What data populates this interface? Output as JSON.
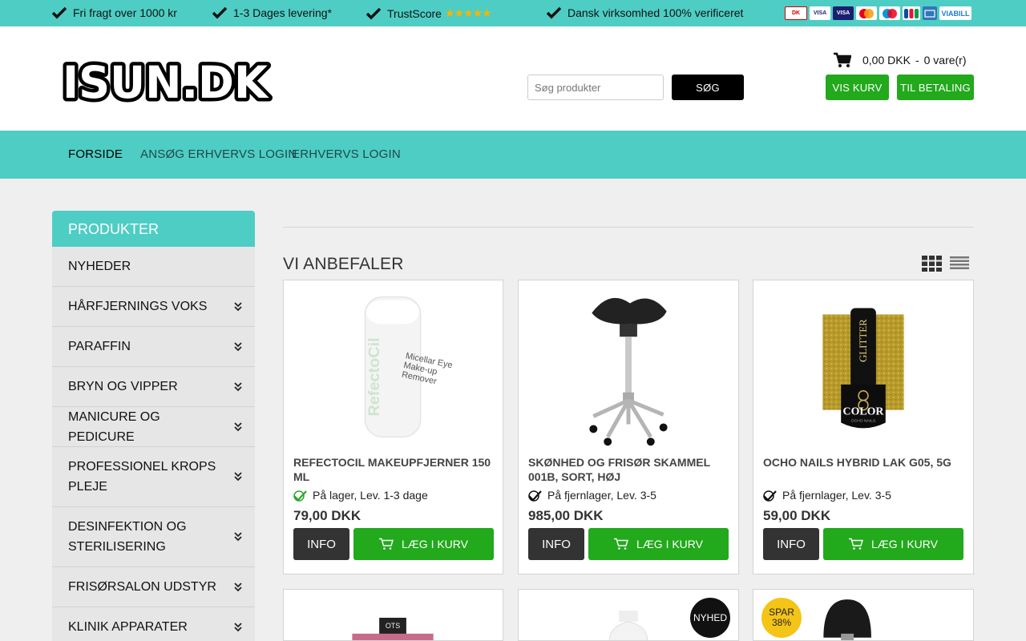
{
  "topbar": {
    "items": [
      {
        "text": "Fri fragt over 1000 kr"
      },
      {
        "text": "1-3 Dages levering*"
      },
      {
        "text": "TrustScore",
        "stars": "★★★★★"
      },
      {
        "text": "Dansk virksomhed 100% verificeret"
      }
    ],
    "payment_logos": [
      "DK",
      "VISA",
      "VISA",
      "MasterCard",
      "Maestro",
      "JCB",
      "AMEX",
      "VIABILL"
    ]
  },
  "header": {
    "logo_text": "ISUN.DK",
    "search": {
      "placeholder": "Søg produkter",
      "button": "Søg"
    },
    "cart": {
      "amount": "0,00 DKK",
      "separator": "-",
      "items": "0 vare(r)"
    },
    "show_cart": "Vis kurv",
    "checkout": "Til betaling"
  },
  "nav": {
    "items": [
      "Forside",
      "Ansøg Erhvervs login",
      "Erhvervs login"
    ]
  },
  "sidebar": {
    "title": "Produkter",
    "items": [
      {
        "label": "NYHEDER",
        "expandable": false
      },
      {
        "label": "HÅRFJERNINGS VOKS",
        "expandable": true
      },
      {
        "label": "PARAFFIN",
        "expandable": true
      },
      {
        "label": "BRYN OG VIPPER",
        "expandable": true
      },
      {
        "label": "MANICURE OG PEDICURE",
        "expandable": true
      },
      {
        "label": "PROFESSIONEL KROPS PLEJE",
        "expandable": true
      },
      {
        "label": "DESINFEKTION OG STERILISERING",
        "expandable": true
      },
      {
        "label": "FRISØRSALON UDSTYR",
        "expandable": true
      },
      {
        "label": "KLINIK APPARATER",
        "expandable": true
      }
    ]
  },
  "main": {
    "section_title": "Vi anbefaler",
    "products": [
      {
        "name": "REFECTOCIL MAKEUPFJERNER 150 ML",
        "stock": "På lager,",
        "delivery_label": "Lev.",
        "delivery_days": "1-3",
        "delivery_unit": "dage",
        "price": "79,00 DKK",
        "info": "Info",
        "buy": "Læg i kurv",
        "bottle_text": "Micellar Eye Make-up Remover",
        "brand": "RefectoCil"
      },
      {
        "name": "SKØNHED OG FRISØR SKAMMEL 001B, SORT, HØJ",
        "stock": "På fjernlager,",
        "delivery_label": "Lev.",
        "delivery_days": "3-5",
        "price": "985,00 DKK",
        "info": "Info",
        "buy": "Læg i kurv"
      },
      {
        "name": "OCHO NAILS HYBRID LAK G05, 5G",
        "stock": "På fjernlager,",
        "delivery_label": "Lev.",
        "delivery_days": "3-5",
        "price": "59,00 DKK",
        "info": "Info",
        "buy": "Læg i kurv",
        "bottle_text": "GLITTER",
        "brand": "COLOR",
        "brand_sub": "OCHO NAILS"
      }
    ],
    "row2_badges": {
      "new": "Nyhed",
      "sale": "Spar 38%"
    },
    "row2_product_label": "OTS"
  },
  "colors": {
    "teal": "#4ecdc4",
    "green": "#22a91c",
    "dark": "#333333"
  }
}
